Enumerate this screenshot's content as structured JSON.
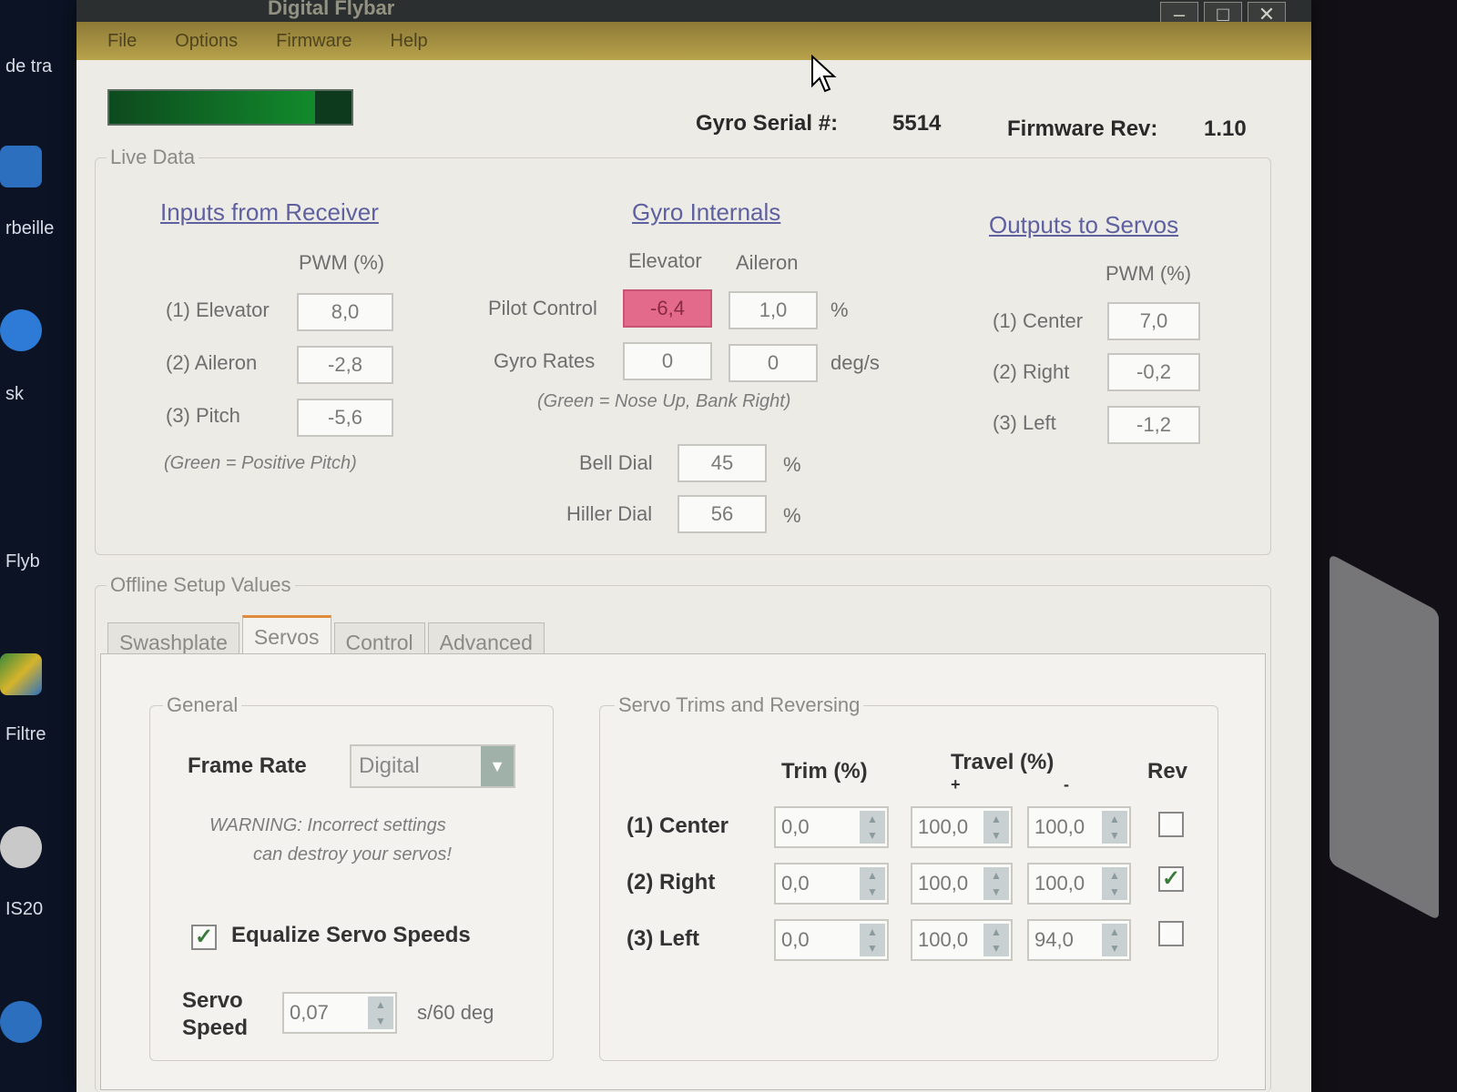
{
  "desktop": {
    "labels": [
      "de tra",
      "rbeille",
      "sk",
      "Flyb",
      "Filtre",
      "IS20"
    ]
  },
  "window": {
    "title": "Digital Flybar",
    "menu": [
      "File",
      "Options",
      "Firmware",
      "Help"
    ],
    "controls": {
      "minimize": "–",
      "maximize": "□",
      "close": "✕"
    }
  },
  "status": {
    "progress": 0.85
  },
  "header": {
    "serial_label": "Gyro Serial #:",
    "serial_value": "5514",
    "firmware_label": "Firmware Rev:",
    "firmware_value": "1.10"
  },
  "live": {
    "legend": "Live Data",
    "inputs": {
      "title": "Inputs from Receiver",
      "col_header": "PWM (%)",
      "rows": [
        {
          "label": "(1) Elevator",
          "value": "8,0"
        },
        {
          "label": "(2) Aileron",
          "value": "-2,8"
        },
        {
          "label": "(3) Pitch",
          "value": "-5,6"
        }
      ],
      "note": "(Green = Positive Pitch)"
    },
    "gyro": {
      "title": "Gyro Internals",
      "col_elevator": "Elevator",
      "col_aileron": "Aileron",
      "pilot_label": "Pilot Control",
      "pilot_elevator": "-6,4",
      "pilot_aileron": "1,0",
      "pilot_unit": "%",
      "rates_label": "Gyro Rates",
      "rates_elevator": "0",
      "rates_aileron": "0",
      "rates_unit": "deg/s",
      "note": "(Green = Nose Up, Bank Right)",
      "bell_label": "Bell Dial",
      "bell_value": "45",
      "bell_unit": "%",
      "hiller_label": "Hiller Dial",
      "hiller_value": "56",
      "hiller_unit": "%"
    },
    "outputs": {
      "title": "Outputs to Servos",
      "col_header": "PWM (%)",
      "rows": [
        {
          "label": "(1) Center",
          "value": "7,0"
        },
        {
          "label": "(2) Right",
          "value": "-0,2"
        },
        {
          "label": "(3) Left",
          "value": "-1,2"
        }
      ]
    }
  },
  "offline": {
    "legend": "Offline Setup Values",
    "tabs": [
      "Swashplate",
      "Servos",
      "Control",
      "Advanced"
    ],
    "active_tab": "Servos",
    "general": {
      "legend": "General",
      "frame_rate_label": "Frame Rate",
      "frame_rate_value": "Digital",
      "warning_line1": "WARNING: Incorrect settings",
      "warning_line2": "can destroy your servos!",
      "equalize_label": "Equalize Servo Speeds",
      "equalize_checked": true,
      "speed_label_1": "Servo",
      "speed_label_2": "Speed",
      "speed_value": "0,07",
      "speed_unit": "s/60 deg"
    },
    "trims": {
      "legend": "Servo Trims and Reversing",
      "col_trim": "Trim (%)",
      "col_travel": "Travel (%)",
      "col_plus": "+",
      "col_minus": "-",
      "col_rev": "Rev",
      "rows": [
        {
          "label": "(1) Center",
          "trim": "0,0",
          "travel_plus": "100,0",
          "travel_minus": "100,0",
          "rev": false
        },
        {
          "label": "(2) Right",
          "trim": "0,0",
          "travel_plus": "100,0",
          "travel_minus": "100,0",
          "rev": true
        },
        {
          "label": "(3) Left",
          "trim": "0,0",
          "travel_plus": "100,0",
          "travel_minus": "94,0",
          "rev": false
        }
      ]
    }
  },
  "colors": {
    "accent_tab": "#e08a3c",
    "pilot_highlight": "#e46a8c",
    "progress": "#128a2c"
  }
}
